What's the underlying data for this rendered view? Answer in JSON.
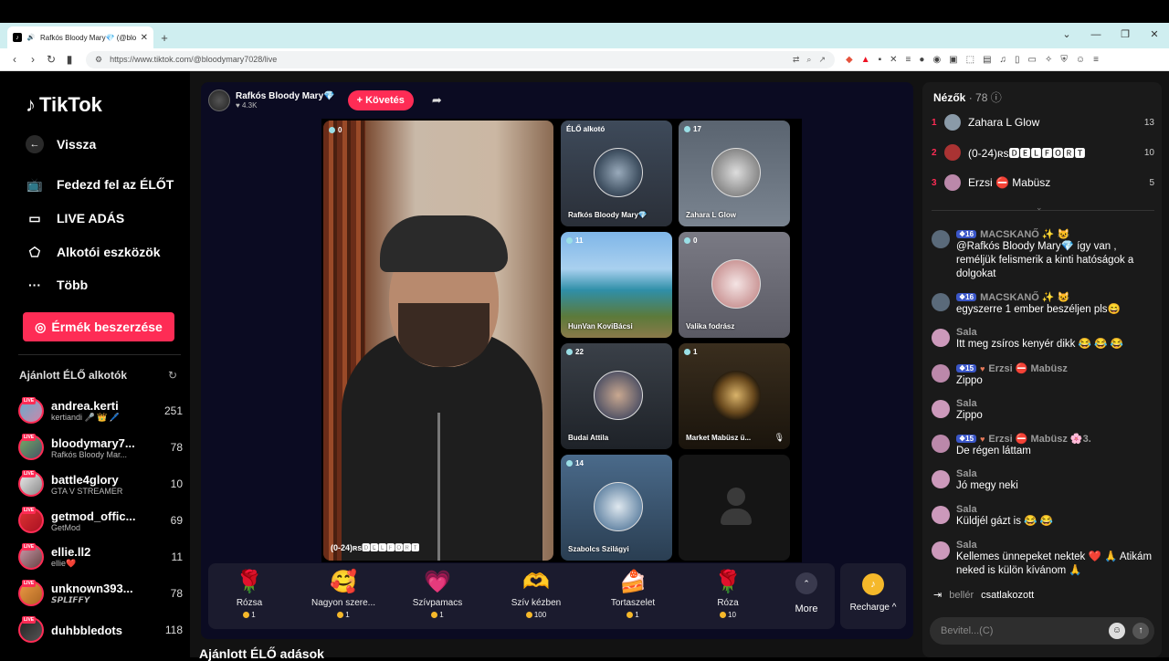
{
  "browser": {
    "tab_title": "Rafkós Bloody Mary💎 (@blo",
    "url": "https://www.tiktok.com/@bloodymary7028/live"
  },
  "sidebar": {
    "logo": "TikTok",
    "back": "Vissza",
    "nav": [
      {
        "label": "Fedezd fel az ÉLŐT",
        "icon": "tv-icon"
      },
      {
        "label": "LIVE ADÁS",
        "icon": "camera-icon"
      },
      {
        "label": "Alkotói eszközök",
        "icon": "creator-tools-icon"
      },
      {
        "label": "Több",
        "icon": "more-icon"
      }
    ],
    "coin_button": "Érmék beszerzése",
    "recommended_title": "Ajánlott ÉLŐ alkotók",
    "live_badge": "LIVE",
    "creators": [
      {
        "name": "andrea.kerti",
        "sub": "kertiandi 🎤 👑 🖊️",
        "count": "251"
      },
      {
        "name": "bloodymary7...",
        "sub": "Rafkós Bloody Mar...",
        "count": "78"
      },
      {
        "name": "battle4glory",
        "sub": "GTA V STREAMER",
        "count": "10"
      },
      {
        "name": "getmod_offic...",
        "sub": "GetMod",
        "count": "69"
      },
      {
        "name": "ellie.ll2",
        "sub": "ellie❤️",
        "count": "11"
      },
      {
        "name": "unknown393...",
        "sub": "𝙎𝙋𝙇𝙄𝙁𝙁𝙔",
        "count": "78"
      },
      {
        "name": "duhbbledots",
        "sub": "",
        "count": "118"
      }
    ]
  },
  "host": {
    "name": "Rafkós Bloody Mary💎",
    "likes": "4.3K",
    "follow": "+ Követés"
  },
  "stage": {
    "main_label": "(0-24)ʀs🅳🅴🅻🅵🅾🆁🆃",
    "tiles": [
      {
        "count": "",
        "top": "ÉLŐ alkotó",
        "label": "Rafkós Bloody Mary💎"
      },
      {
        "count": "17",
        "label": "Zahara L Glow"
      },
      {
        "count": "11",
        "label": "HunVan KoviBácsi"
      },
      {
        "count": "0",
        "label": "Valika fodrász"
      },
      {
        "count": "22",
        "label": "Budai Attila"
      },
      {
        "count": "1",
        "label": "Market Mabüsz ü..."
      },
      {
        "count": "14",
        "label": "Szabolcs Szilágyi"
      }
    ],
    "main_count": "0"
  },
  "gifts": [
    {
      "name": "Rózsa",
      "price": "1",
      "icon": "🌹"
    },
    {
      "name": "Nagyon szere...",
      "price": "1",
      "icon": "🥰"
    },
    {
      "name": "Szívpamacs",
      "price": "1",
      "icon": "💗"
    },
    {
      "name": "Szív kézben",
      "price": "100",
      "icon": "🫶"
    },
    {
      "name": "Tortaszelet",
      "price": "1",
      "icon": "🍰"
    },
    {
      "name": "Róza",
      "price": "10",
      "icon": "🌹"
    }
  ],
  "more_label": "More",
  "recharge_label": "Recharge ^",
  "bottom_heading": "Ajánlott ÉLŐ adások",
  "viewers": {
    "title": "Nézők",
    "count": "· 78",
    "list": [
      {
        "rank": "1",
        "name": "Zahara L Glow",
        "score": "13"
      },
      {
        "rank": "2",
        "name": "(0-24)ʀs🅳🅴🅻🅵🅾🆁🆃",
        "score": "10"
      },
      {
        "rank": "3",
        "name": "Erzsi ⛔ Mabüsz",
        "score": "5"
      }
    ]
  },
  "chat": [
    {
      "level": "16",
      "name": "MACSKANŐ ✨ 😺",
      "msg": "@Rafkós Bloody Mary💎 így van , reméljük felismerik a kinti hatóságok a dolgokat"
    },
    {
      "level": "16",
      "name": "MACSKANŐ ✨ 😺",
      "msg": "egyszerre 1 ember beszéljen pls😄"
    },
    {
      "level": "",
      "name": "Sala",
      "msg": "Itt meg zsíros kenyér dikk 😂 😂 😂"
    },
    {
      "level": "15",
      "name": "Erzsi ⛔ Mabüsz",
      "msg": "Zippo"
    },
    {
      "level": "",
      "name": "Sala",
      "msg": "Zippo"
    },
    {
      "level": "15",
      "name": "Erzsi ⛔ Mabüsz 🌸3.",
      "msg": "De régen láttam"
    },
    {
      "level": "",
      "name": "Sala",
      "msg": "Jó megy neki"
    },
    {
      "level": "",
      "name": "Sala",
      "msg": "Küldjél gázt is 😂 😂"
    },
    {
      "level": "",
      "name": "Sala",
      "msg": "Kellemes ünnepeket nektek ❤️ 🙏 Atikám neked is külön kívánom 🙏"
    }
  ],
  "joined": {
    "user": "bellér",
    "text": "csatlakozott"
  },
  "input_placeholder": "Bevitel...(C)"
}
